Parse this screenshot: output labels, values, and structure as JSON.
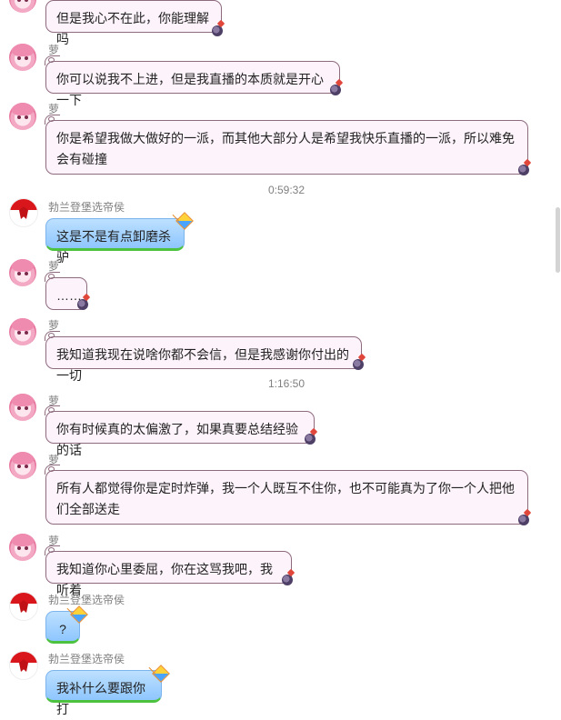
{
  "senders": {
    "meng": "萝",
    "official": "勃兰登堡选帝侯"
  },
  "messages": [
    {
      "text": "但是我心不在此，你能理解吗"
    },
    {
      "text": "你可以说我不上进，但是我直播的本质就是开心一下"
    },
    {
      "text": "你是希望我做大做好的一派，而其他大部分人是希望我快乐直播的一派，所以难免会有碰撞"
    },
    {
      "time": "0:59:32"
    },
    {
      "text": "这是不是有点卸磨杀驴"
    },
    {
      "text": "……"
    },
    {
      "text": "我知道我现在说啥你都不会信，但是我感谢你付出的一切"
    },
    {
      "time": "1:16:50"
    },
    {
      "text": "你有时候真的太偏激了，如果真要总结经验的话"
    },
    {
      "text": "所有人都觉得你是定时炸弹，我一个人既互不住你，也不可能真为了你一个人把他们全部送走"
    },
    {
      "text": "我知道你心里委屈，你在这骂我吧，我听着"
    },
    {
      "text": "?"
    },
    {
      "text": "我补什么要跟你打"
    }
  ],
  "colors": {
    "pink_bubble_bg": "#fdf4fb",
    "pink_bubble_border": "#8e6a7e",
    "blue_bubble_top": "#bde0ff",
    "blue_bubble_bottom": "#8ec6ff",
    "blue_bubble_accent": "#4cc23f",
    "timestamp": "#808080"
  }
}
